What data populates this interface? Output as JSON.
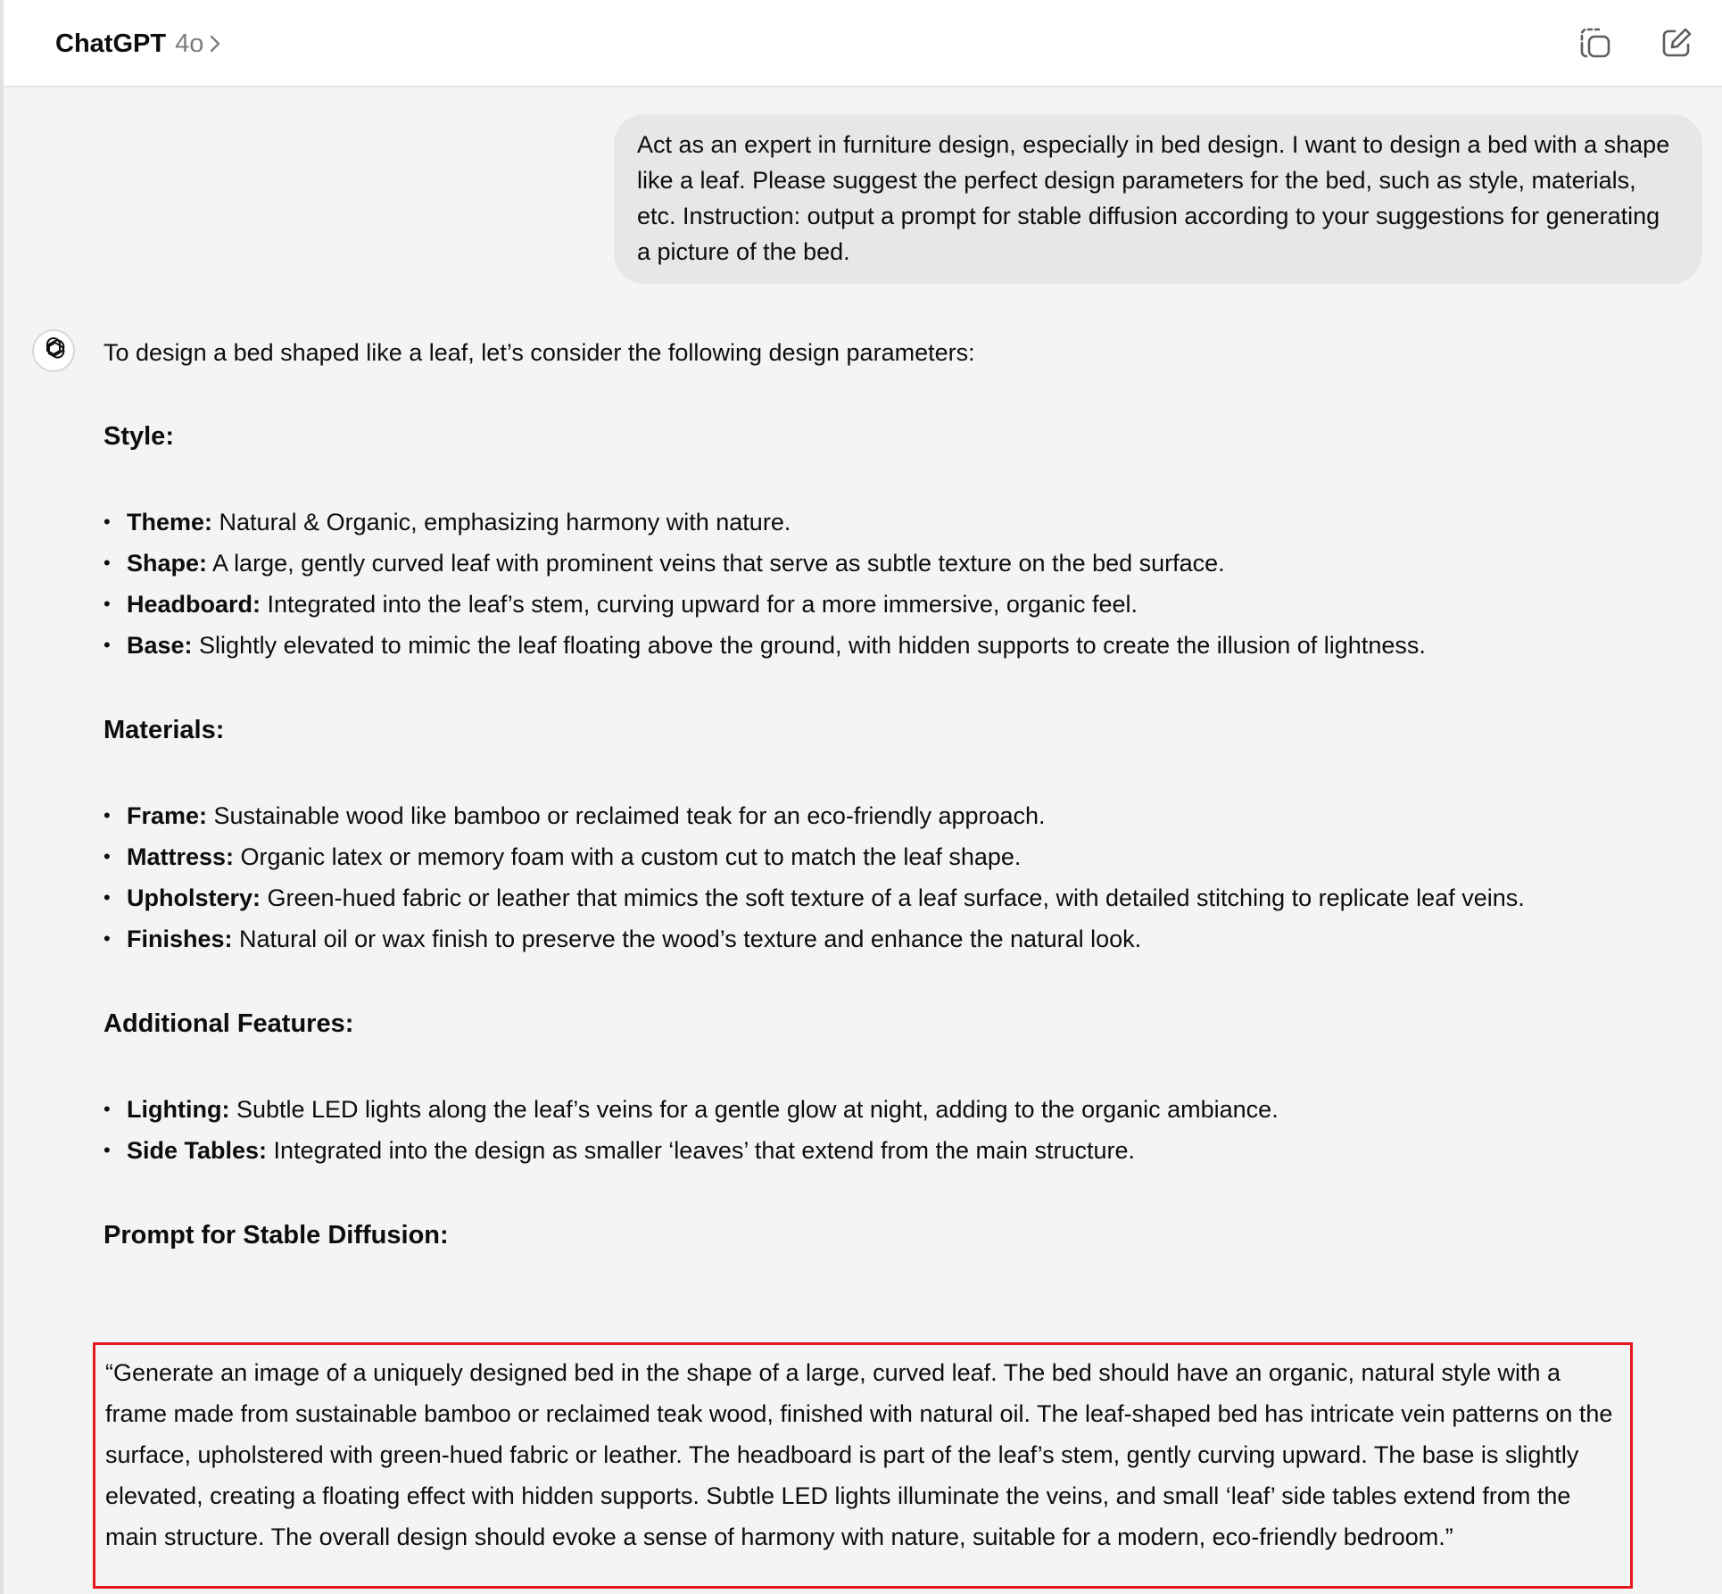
{
  "header": {
    "model_name": "ChatGPT",
    "model_version": "4o"
  },
  "icons": {
    "model_chevron": "chevron-right-icon",
    "temporary_chat": "temporary-chat-icon",
    "new_chat": "new-chat-icon",
    "assistant_avatar": "openai-logo-icon"
  },
  "colors": {
    "highlight_border": "#e5171f",
    "user_bubble": "#e7e7e7",
    "page_background": "#f4f4f4"
  },
  "user_message": "Act as an expert in furniture design, especially in bed design. I want to design a bed with a shape like a leaf. Please suggest the perfect design parameters for the bed, such as style, materials, etc. Instruction: output a prompt for stable diffusion according to your suggestions for generating a picture of the bed.",
  "response": {
    "intro": "To design a bed shaped like a leaf, let’s consider the following design parameters:",
    "sections": [
      {
        "heading": "Style:",
        "items": [
          {
            "label": "Theme:",
            "text": " Natural & Organic, emphasizing harmony with nature."
          },
          {
            "label": "Shape:",
            "text": " A large, gently curved leaf with prominent veins that serve as subtle texture on the bed surface."
          },
          {
            "label": "Headboard:",
            "text": " Integrated into the leaf’s stem, curving upward for a more immersive, organic feel."
          },
          {
            "label": "Base:",
            "text": " Slightly elevated to mimic the leaf floating above the ground, with hidden supports to create the illusion of lightness."
          }
        ]
      },
      {
        "heading": "Materials:",
        "items": [
          {
            "label": "Frame:",
            "text": " Sustainable wood like bamboo or reclaimed teak for an eco-friendly approach."
          },
          {
            "label": "Mattress:",
            "text": " Organic latex or memory foam with a custom cut to match the leaf shape."
          },
          {
            "label": "Upholstery:",
            "text": " Green-hued fabric or leather that mimics the soft texture of a leaf surface, with detailed stitching to replicate leaf veins."
          },
          {
            "label": "Finishes:",
            "text": " Natural oil or wax finish to preserve the wood’s texture and enhance the natural look."
          }
        ]
      },
      {
        "heading": "Additional Features:",
        "items": [
          {
            "label": "Lighting:",
            "text": " Subtle LED lights along the leaf’s veins for a gentle glow at night, adding to the organic ambiance."
          },
          {
            "label": "Side Tables:",
            "text": " Integrated into the design as smaller ‘leaves’ that extend from the main structure."
          }
        ]
      }
    ],
    "prompt_heading": "Prompt for Stable Diffusion:",
    "prompt_text": "“Generate an image of a uniquely designed bed in the shape of a large, curved leaf. The bed should have an organic, natural style with a frame made from sustainable bamboo or reclaimed teak wood, finished with natural oil. The leaf-shaped bed has intricate vein patterns on the surface, upholstered with green-hued fabric or leather. The headboard is part of the leaf’s stem, gently curving upward. The base is slightly elevated, creating a floating effect with hidden supports. Subtle LED lights illuminate the veins, and small ‘leaf’ side tables extend from the main structure. The overall design should evoke a sense of harmony with nature, suitable for a modern, eco-friendly bedroom.”"
  }
}
